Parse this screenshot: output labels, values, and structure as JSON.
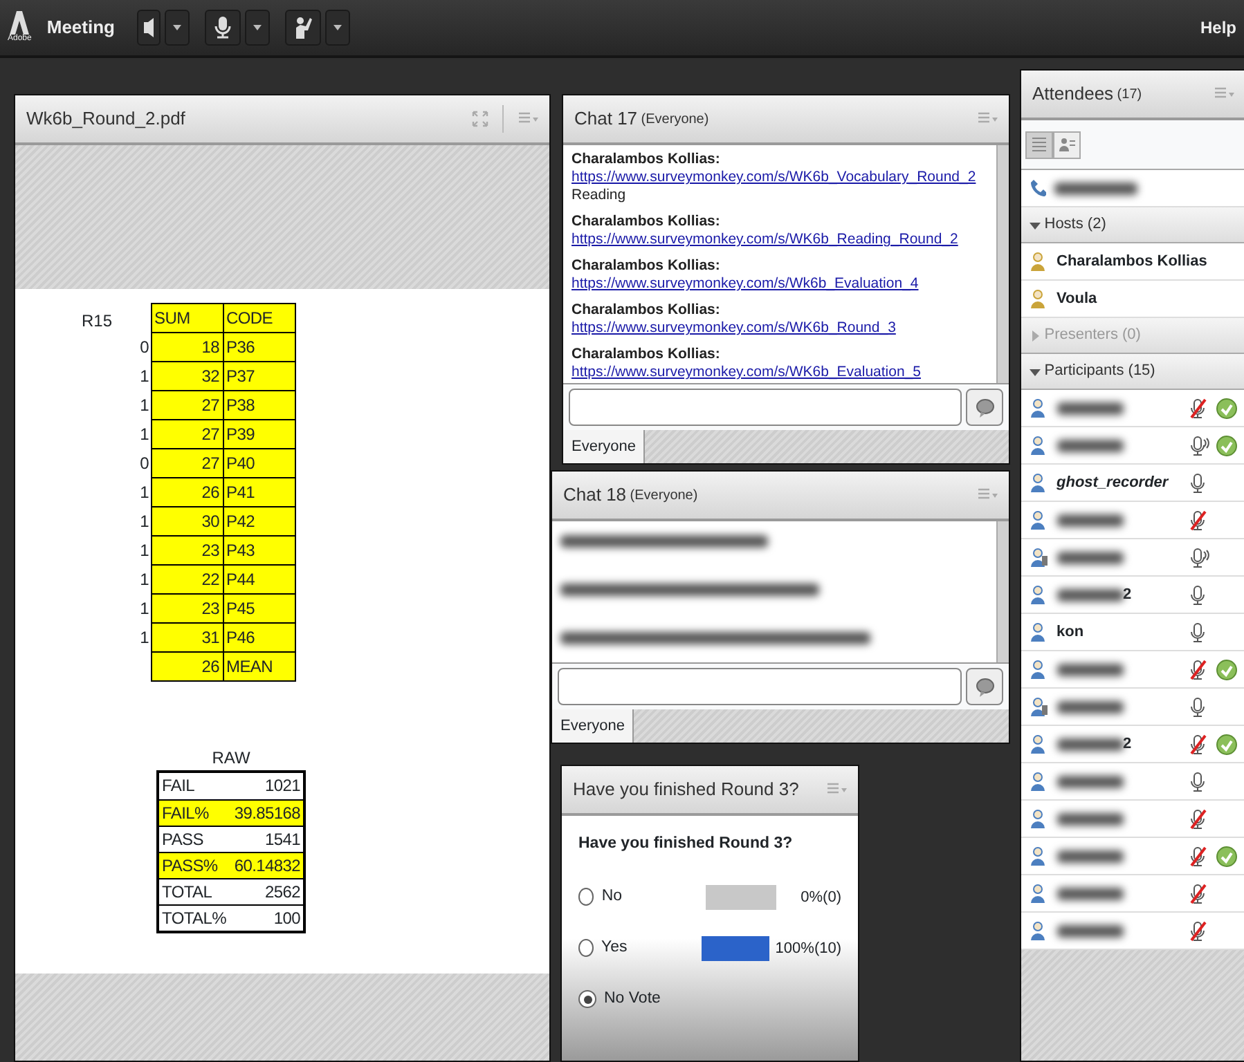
{
  "topbar": {
    "logo_text": "Adobe",
    "menu": "Meeting",
    "buttons": [
      {
        "kind": "speaker"
      },
      {
        "kind": "mic"
      },
      {
        "kind": "hand"
      }
    ],
    "help": "Help"
  },
  "pdf_pod": {
    "title": "Wk6b_Round_2.pdf",
    "sheet_label": "R15",
    "table": {
      "columns": [
        "SUM",
        "CODE"
      ],
      "rows": [
        {
          "flag": "0",
          "sum": "18",
          "code": "P36"
        },
        {
          "flag": "1",
          "sum": "32",
          "code": "P37"
        },
        {
          "flag": "1",
          "sum": "27",
          "code": "P38"
        },
        {
          "flag": "1",
          "sum": "27",
          "code": "P39"
        },
        {
          "flag": "0",
          "sum": "27",
          "code": "P40"
        },
        {
          "flag": "1",
          "sum": "26",
          "code": "P41"
        },
        {
          "flag": "1",
          "sum": "30",
          "code": "P42"
        },
        {
          "flag": "1",
          "sum": "23",
          "code": "P43"
        },
        {
          "flag": "1",
          "sum": "22",
          "code": "P44"
        },
        {
          "flag": "1",
          "sum": "23",
          "code": "P45"
        },
        {
          "flag": "1",
          "sum": "31",
          "code": "P46"
        },
        {
          "sum": "26",
          "code": "MEAN"
        }
      ]
    },
    "raw": {
      "title": "RAW",
      "rows": [
        {
          "label": "FAIL",
          "value": "1021",
          "highlighted": false
        },
        {
          "label": "FAIL%",
          "value": "39.85168",
          "highlighted": true
        },
        {
          "label": "PASS",
          "value": "1541",
          "highlighted": false
        },
        {
          "label": "PASS%",
          "value": "60.14832",
          "highlighted": true
        },
        {
          "label": "TOTAL",
          "value": "2562",
          "highlighted": false
        },
        {
          "label": "TOTAL%",
          "value": "100",
          "highlighted": false
        }
      ]
    }
  },
  "chats": [
    {
      "title": "Chat 17",
      "audience": "(Everyone)",
      "tab": "Everyone",
      "messages": [
        {
          "kind": "link",
          "sender": "Charalambos Kollias:",
          "link": "https://www.surveymonkey.com/s/WK6b_Vocabulary_Round_2",
          "text": "Reading"
        },
        {
          "kind": "link",
          "sender": "Charalambos Kollias:",
          "link": "https://www.surveymonkey.com/s/WK6b_Reading_Round_2"
        },
        {
          "kind": "link",
          "sender": "Charalambos Kollias:",
          "link": "https://www.surveymonkey.com/s/Wk6b_Evaluation_4"
        },
        {
          "kind": "link",
          "sender": "Charalambos Kollias:",
          "link": "https://www.surveymonkey.com/s/WK6b_Round_3"
        },
        {
          "kind": "link",
          "sender": "Charalambos Kollias:",
          "link": "https://www.surveymonkey.com/s/WK6b_Evaluation_5"
        }
      ]
    },
    {
      "title": "Chat 18",
      "audience": "(Everyone)",
      "tab": "Everyone",
      "messages": [
        {
          "kind": "blurred"
        },
        {
          "kind": "blurred"
        },
        {
          "kind": "blurred"
        }
      ]
    }
  ],
  "poll": {
    "title": "Have you finished Round 3?",
    "question": "Have you finished Round 3?",
    "options": [
      {
        "label": "No",
        "selected": false,
        "level": 0,
        "percent": "0%",
        "count": "(0)"
      },
      {
        "label": "Yes",
        "selected": false,
        "level": 1,
        "percent": "100%",
        "count": "(10)"
      },
      {
        "label": "No Vote",
        "selected": true
      }
    ]
  },
  "attendees": {
    "title": "Attendees",
    "count": "(17)",
    "views": [
      {
        "kind": "list",
        "selected": true
      },
      {
        "kind": "card",
        "selected": false
      }
    ],
    "phone_row": {
      "blurred": true
    },
    "sections": [
      {
        "label": "Hosts (2)",
        "expanded": true,
        "children": [
          {
            "kind": "host",
            "name": "Charalambos Kollias",
            "blurred": false,
            "italic": false,
            "agreed": false
          },
          {
            "kind": "host",
            "name": "Voula",
            "blurred": false,
            "italic": false,
            "agreed": false
          }
        ]
      },
      {
        "label": "Presenters (0)",
        "expanded": false
      },
      {
        "label": "Participants (15)",
        "expanded": true,
        "children": [
          {
            "kind": "computer",
            "blurred": true,
            "mic": {
              "kind": "muted"
            },
            "agreed": true
          },
          {
            "kind": "computer",
            "blurred": true,
            "mic": {
              "kind": "speaking"
            },
            "agreed": true
          },
          {
            "kind": "computer",
            "name": "ghost_recorder",
            "blurred": false,
            "italic": true,
            "mic": {
              "kind": "on"
            },
            "agreed": false
          },
          {
            "kind": "computer",
            "blurred": true,
            "mic": {
              "kind": "muted"
            },
            "agreed": false
          },
          {
            "kind": "phone",
            "blurred": true,
            "mic": {
              "kind": "speaking"
            },
            "agreed": false
          },
          {
            "kind": "computer",
            "name": "2",
            "blurred": true,
            "italic": false,
            "mic": {
              "kind": "on"
            },
            "agreed": false
          },
          {
            "kind": "computer",
            "name": "kon",
            "blurred": false,
            "italic": false,
            "mic": {
              "kind": "on"
            },
            "agreed": false
          },
          {
            "kind": "computer",
            "blurred": true,
            "mic": {
              "kind": "muted"
            },
            "agreed": true
          },
          {
            "kind": "phone",
            "blurred": true,
            "mic": {
              "kind": "on"
            },
            "agreed": false
          },
          {
            "kind": "computer",
            "name": "2",
            "blurred": true,
            "italic": false,
            "mic": {
              "kind": "muted"
            },
            "agreed": true
          },
          {
            "kind": "computer",
            "blurred": true,
            "mic": {
              "kind": "on"
            },
            "agreed": false
          },
          {
            "kind": "computer",
            "blurred": true,
            "mic": {
              "kind": "muted"
            },
            "agreed": false
          },
          {
            "kind": "computer",
            "blurred": true,
            "mic": {
              "kind": "muted"
            },
            "agreed": true
          },
          {
            "kind": "computer",
            "blurred": true,
            "mic": {
              "kind": "muted"
            },
            "agreed": false
          },
          {
            "kind": "computer",
            "blurred": true,
            "mic": {
              "kind": "muted"
            },
            "agreed": false
          }
        ]
      }
    ]
  }
}
